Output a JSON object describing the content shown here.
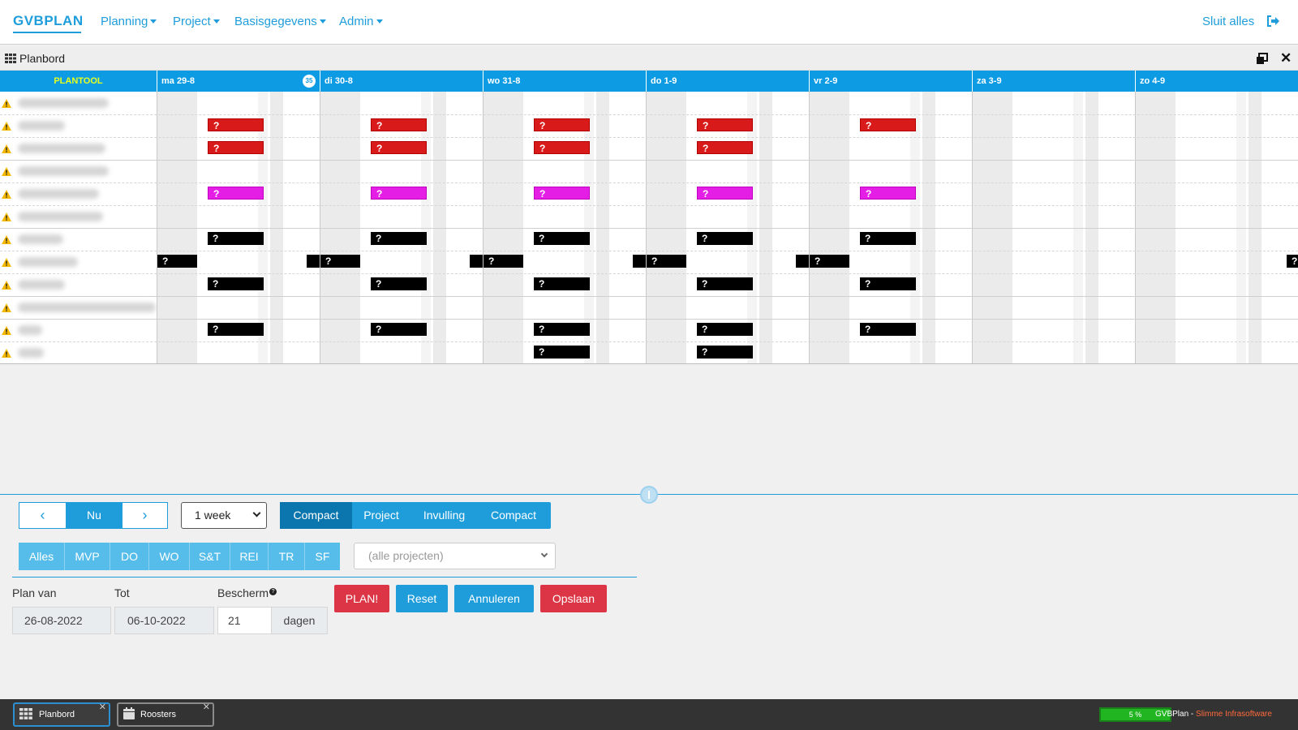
{
  "app": {
    "brand": "GVBPLAN",
    "menu": [
      "Planning",
      "Project",
      "Basisgegevens",
      "Admin"
    ],
    "close_all": "Sluit alles"
  },
  "window": {
    "title": "Planbord"
  },
  "board": {
    "first_header": "PLANTOOL",
    "week_number": "35",
    "days": [
      "ma 29-8",
      "di 30-8",
      "wo 31-8",
      "do 1-9",
      "vr 2-9",
      "za 3-9",
      "zo 4-9"
    ],
    "row_count": 12,
    "task_marker": "?",
    "colors": {
      "header": "#0d9ce4",
      "red_task": "#d91a1a",
      "magenta_task": "#e51ee5",
      "black_task": "#000000",
      "plantool_text": "#e8ff1e",
      "warning": "#f5b800"
    }
  },
  "controls": {
    "prev": "‹",
    "now": "Nu",
    "next": "›",
    "period": "1 week",
    "views": [
      "Compact",
      "Project",
      "Invulling",
      "Compact"
    ],
    "filters": [
      "Alles",
      "MVP",
      "DO",
      "WO",
      "S&T",
      "REI",
      "TR",
      "SF"
    ],
    "project_placeholder": "(alle projecten)",
    "plan_from_label": "Plan van",
    "to_label": "Tot",
    "protect_label": "Bescherm",
    "help": "?",
    "plan_from": "26-08-2022",
    "to": "06-10-2022",
    "protect_days": "21",
    "days_unit": "dagen",
    "actions": [
      "PLAN!",
      "Reset",
      "Annuleren",
      "Opslaan"
    ]
  },
  "taskbar": {
    "tabs": [
      "Planbord",
      "Roosters"
    ],
    "progress": "5 %",
    "footer_app": "GVBPlan",
    "footer_sep": " - ",
    "footer_company": "Slimme Infrasoftware"
  }
}
